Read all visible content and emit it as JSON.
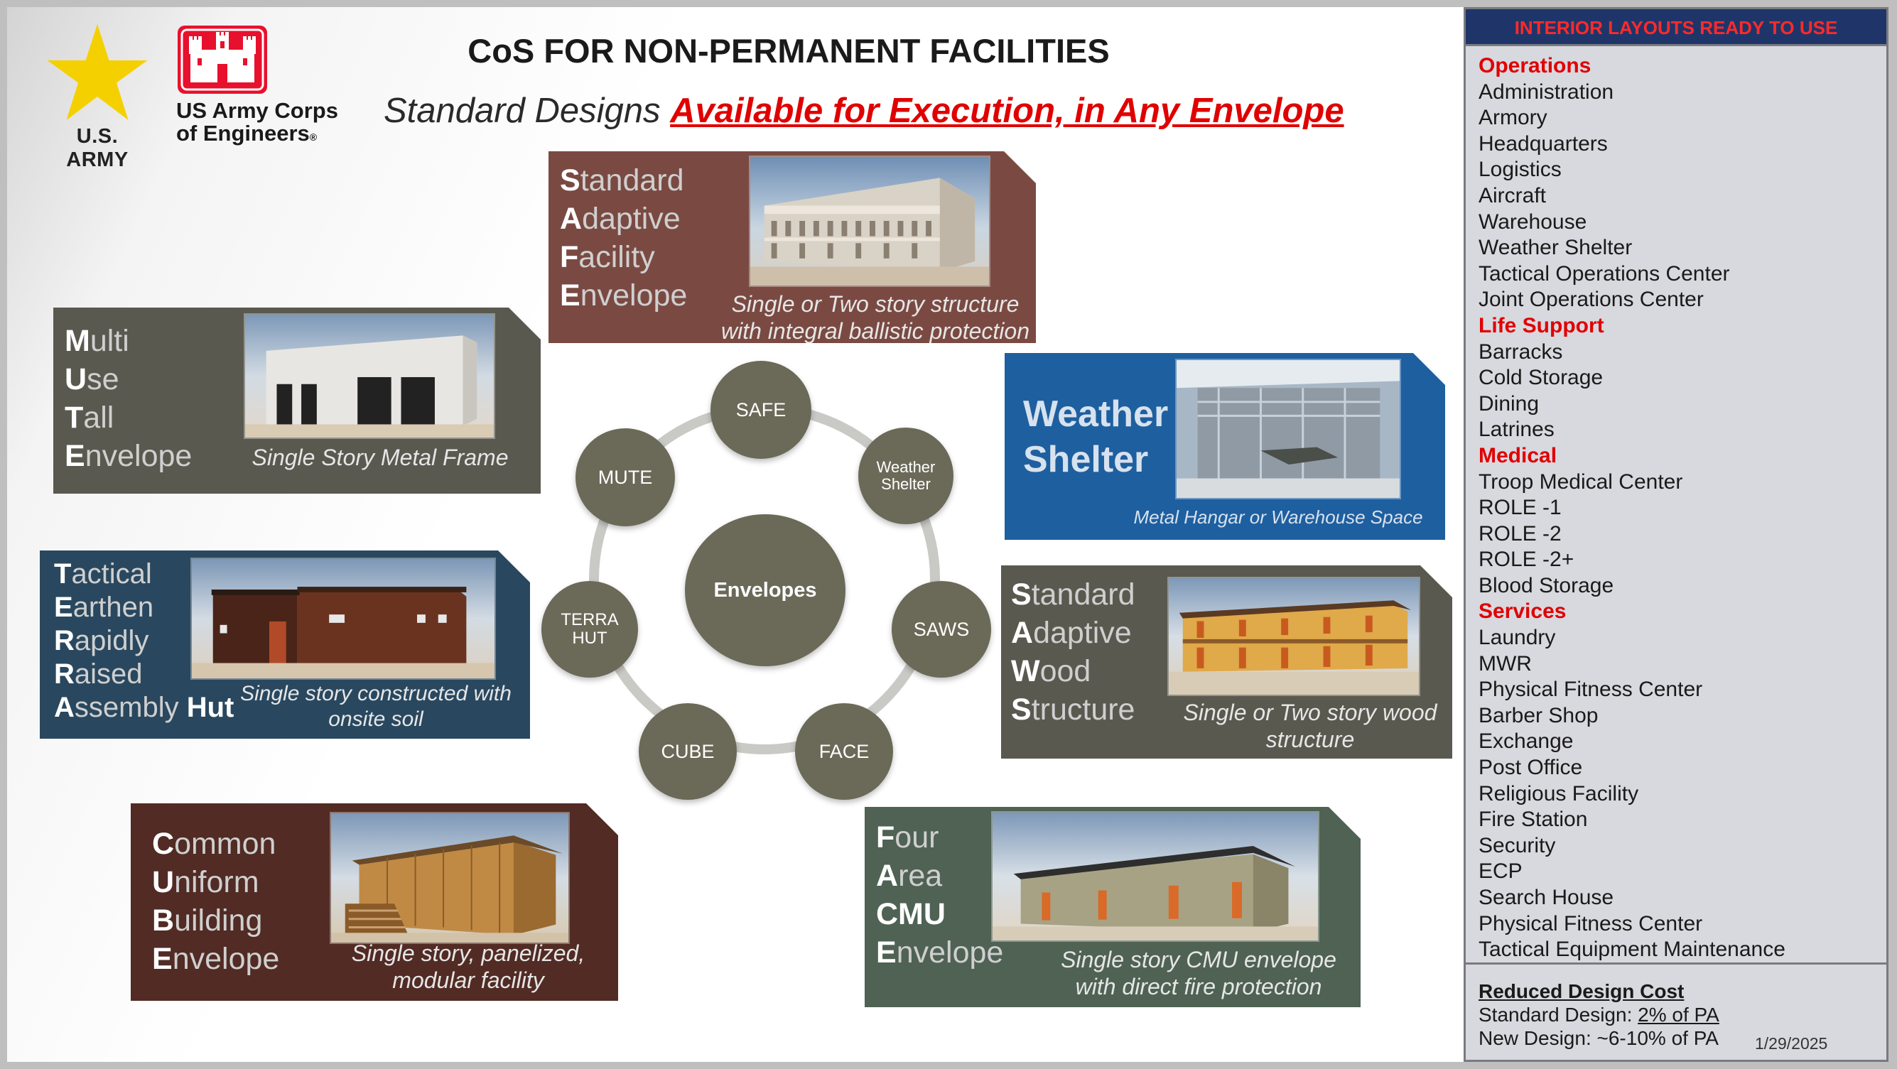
{
  "header": {
    "army_label": "U.S. ARMY",
    "usace_line1": "US Army Corps",
    "usace_line2": "of Engineers",
    "usace_reg": "®",
    "title": "CoS FOR NON-PERMANENT FACILITIES",
    "subtitle_plain": "Standard Designs ",
    "subtitle_highlight": "Available for Execution, in Any Envelope"
  },
  "cards": {
    "safe": {
      "l1": [
        "S",
        "tandard"
      ],
      "l2": [
        "A",
        "daptive"
      ],
      "l3": [
        "F",
        "acility"
      ],
      "l4": [
        "E",
        "nvelope"
      ],
      "desc1": "Single or Two story structure",
      "desc2": "with integral ballistic protection"
    },
    "mute": {
      "l1": [
        "M",
        "ulti"
      ],
      "l2": [
        "U",
        "se"
      ],
      "l3": [
        "T",
        "all"
      ],
      "l4": [
        "E",
        "nvelope"
      ],
      "desc1": "Single Story Metal Frame"
    },
    "weather": {
      "l1": "Weather",
      "l2": "Shelter",
      "desc1": "Metal Hangar or Warehouse Space"
    },
    "terra": {
      "l1": [
        "T",
        "actical"
      ],
      "l2": [
        "E",
        "arthen"
      ],
      "l3": [
        "R",
        "apidly"
      ],
      "l4": [
        "R",
        "aised"
      ],
      "l5a": "A",
      "l5b": "ssembly ",
      "l5c": "Hut",
      "desc1": "Single story constructed with",
      "desc2": "onsite soil"
    },
    "saws": {
      "l1": [
        "S",
        "tandard"
      ],
      "l2": [
        "A",
        "daptive"
      ],
      "l3": [
        "W",
        "ood"
      ],
      "l4": [
        "S",
        "tructure"
      ],
      "desc1": "Single or Two story wood",
      "desc2": "structure"
    },
    "cube": {
      "l1": [
        "C",
        "ommon"
      ],
      "l2": [
        "U",
        "niform"
      ],
      "l3": [
        "B",
        "uilding"
      ],
      "l4": [
        "E",
        "nvelope"
      ],
      "desc1": "Single story, panelized,",
      "desc2": "modular facility"
    },
    "face": {
      "l1": [
        "F",
        "our"
      ],
      "l2": [
        "A",
        "rea"
      ],
      "l3": [
        "CMU",
        ""
      ],
      "l4": [
        "E",
        "nvelope"
      ],
      "desc1": "Single story CMU envelope",
      "desc2": "with direct fire protection"
    }
  },
  "diagram": {
    "center": "Envelopes",
    "nodes": {
      "safe": "SAFE",
      "weather_1": "Weather",
      "weather_2": "Shelter",
      "saws": "SAWS",
      "face": "FACE",
      "cube": "CUBE",
      "terra_1": "TERRA",
      "terra_2": "HUT",
      "mute": "MUTE"
    }
  },
  "panel": {
    "heading": "INTERIOR LAYOUTS READY TO USE",
    "items": [
      {
        "text": "Operations",
        "category": true
      },
      {
        "text": "Administration",
        "category": false
      },
      {
        "text": "Armory",
        "category": false
      },
      {
        "text": "Headquarters",
        "category": false
      },
      {
        "text": "Logistics",
        "category": false
      },
      {
        "text": "Aircraft",
        "category": false
      },
      {
        "text": "Warehouse",
        "category": false
      },
      {
        "text": "Weather Shelter",
        "category": false
      },
      {
        "text": "Tactical Operations Center",
        "category": false
      },
      {
        "text": "Joint Operations Center",
        "category": false
      },
      {
        "text": "Life Support",
        "category": true
      },
      {
        "text": "Barracks",
        "category": false
      },
      {
        "text": "Cold Storage",
        "category": false
      },
      {
        "text": "Dining",
        "category": false
      },
      {
        "text": "Latrines",
        "category": false
      },
      {
        "text": "Medical",
        "category": true
      },
      {
        "text": "Troop Medical Center",
        "category": false
      },
      {
        "text": "ROLE -1",
        "category": false
      },
      {
        "text": "ROLE -2",
        "category": false
      },
      {
        "text": "ROLE -2+",
        "category": false
      },
      {
        "text": "Blood Storage",
        "category": false
      },
      {
        "text": "Services",
        "category": true
      },
      {
        "text": "Laundry",
        "category": false
      },
      {
        "text": "MWR",
        "category": false
      },
      {
        "text": "Physical Fitness Center",
        "category": false
      },
      {
        "text": "Barber Shop",
        "category": false
      },
      {
        "text": "Exchange",
        "category": false
      },
      {
        "text": "Post Office",
        "category": false
      },
      {
        "text": "Religious Facility",
        "category": false
      },
      {
        "text": "Fire Station",
        "category": false
      },
      {
        "text": "Security",
        "category": false
      },
      {
        "text": "ECP",
        "category": false
      },
      {
        "text": "Search House",
        "category": false
      },
      {
        "text": "Physical Fitness Center",
        "category": false
      },
      {
        "text": "Tactical Equipment Maintenance",
        "category": false
      }
    ],
    "cost": {
      "heading": "Reduced Design Cost",
      "std_label": "Standard Design: ",
      "std_value": "2% of PA",
      "new_label": "New Design: ~6-10% of PA"
    }
  },
  "date": "1/29/2025",
  "colors": {
    "accent_red": "#e00000",
    "panel_header": "#1f3569",
    "node_fill": "#6b6a59",
    "weather_blue": "#1e5fa0"
  }
}
